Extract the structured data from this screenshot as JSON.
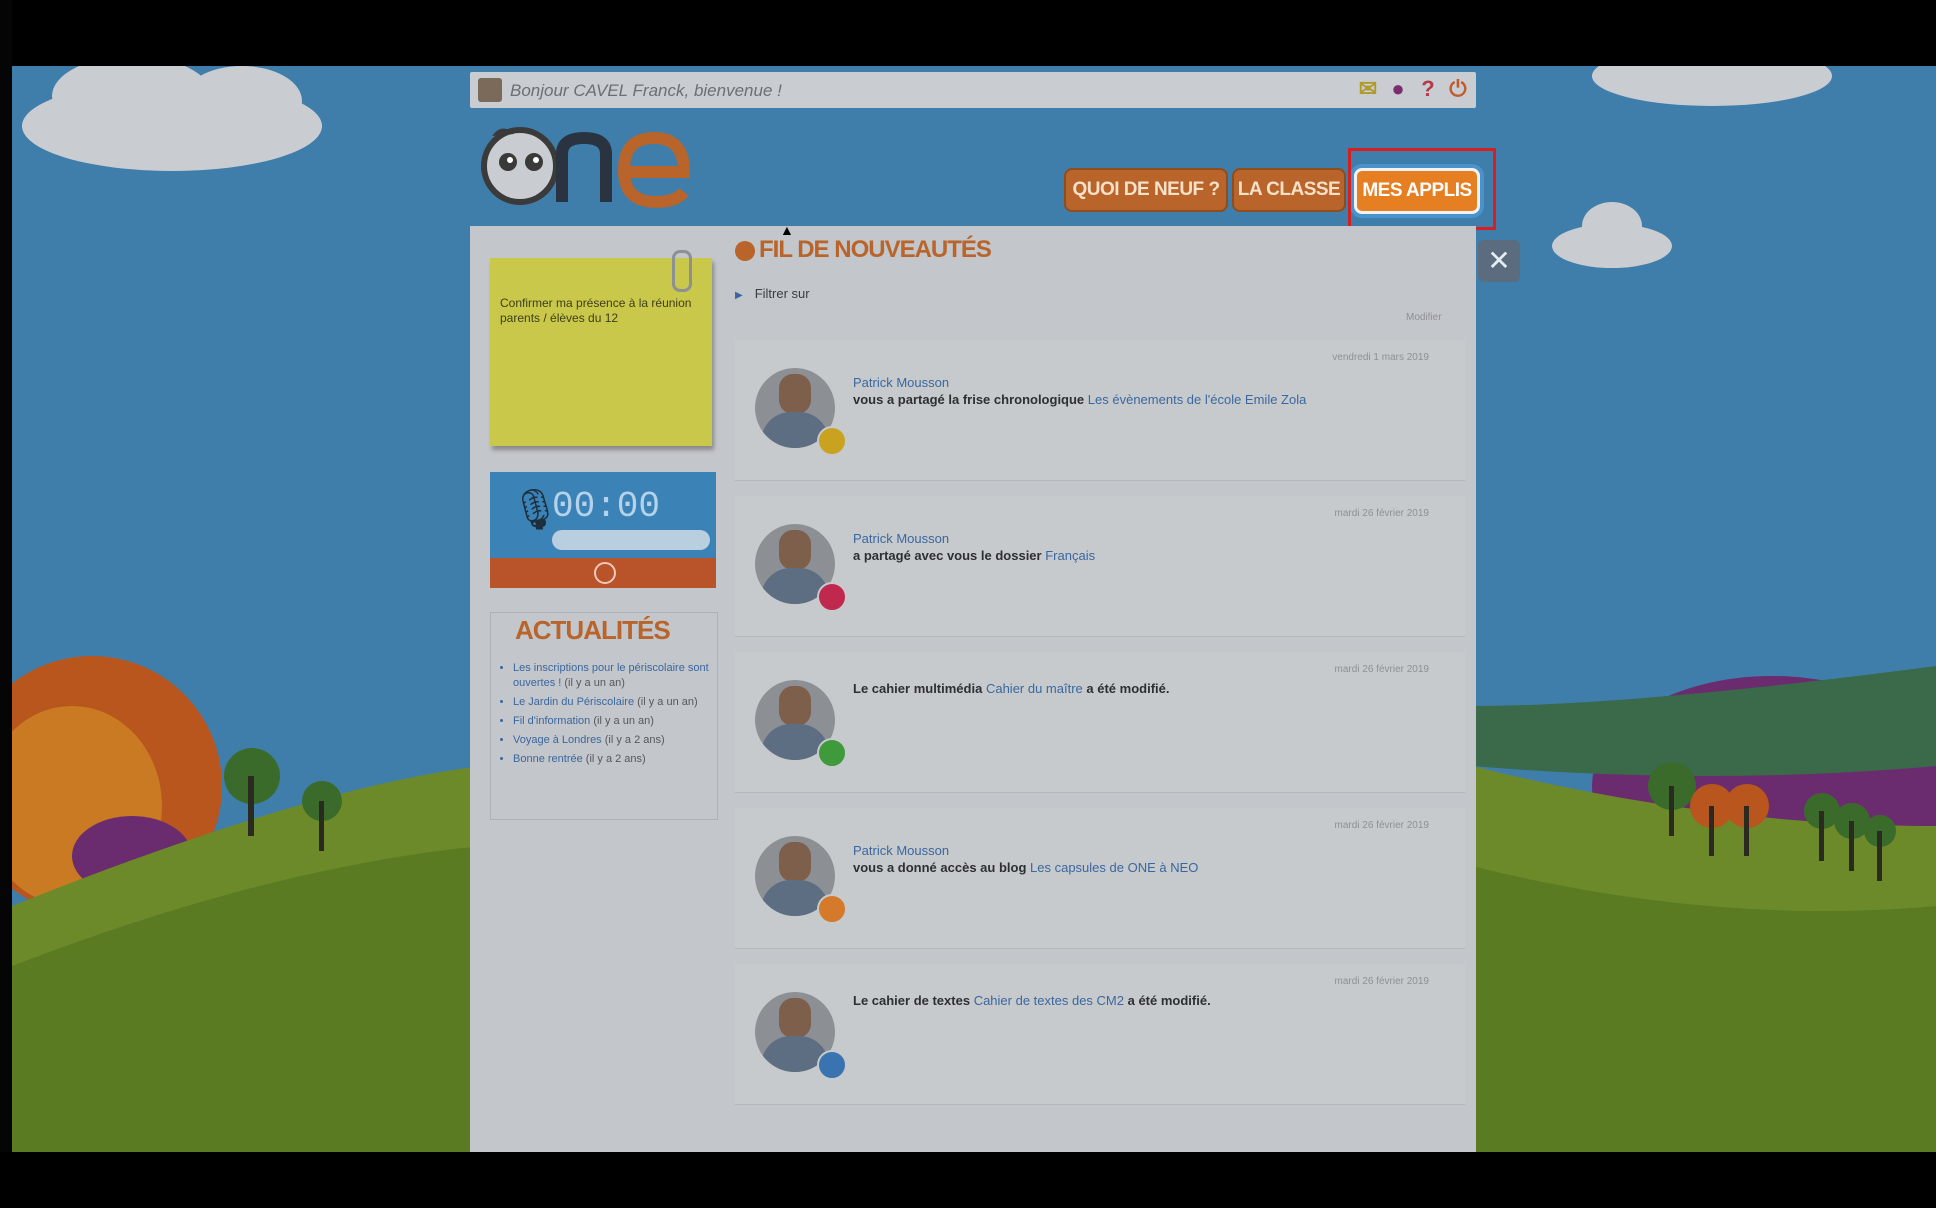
{
  "header": {
    "greeting": "Bonjour CAVEL Franck, bienvenue !",
    "icons": [
      "mail-icon",
      "user-icon",
      "help-icon",
      "power-icon"
    ]
  },
  "nav": {
    "items": [
      "QUOI DE NEUF ?",
      "LA CLASSE",
      "MES APPLIS"
    ],
    "active": "MES APPLIS"
  },
  "sidebar": {
    "postit_text": "Confirmer ma présence à la réunion parents / élèves du 12",
    "recorder_time": "00:00",
    "news_title": "ACTUALITÉS",
    "news": [
      {
        "title": "Les inscriptions pour le périscolaire sont ouvertes !",
        "age": "(il y a un an)"
      },
      {
        "title": "Le Jardin du Périscolaire",
        "age": "(il y a un an)"
      },
      {
        "title": "Fil d'information",
        "age": "(il y a un an)"
      },
      {
        "title": "Voyage à Londres",
        "age": "(il y a 2 ans)"
      },
      {
        "title": "Bonne rentrée",
        "age": "(il y a 2 ans)"
      }
    ]
  },
  "feed": {
    "title": "FIL DE NOUVEAUTÉS",
    "filter": "Filtrer sur",
    "show_all": "Modifier",
    "items": [
      {
        "date": "vendredi 1 mars 2019",
        "author": "Patrick Mousson",
        "text": "vous a partagé la frise chronologique",
        "link": "Les évènements de l'école Emile Zola",
        "badge_color": "#c9a220"
      },
      {
        "date": "mardi 26 février 2019",
        "author": "Patrick Mousson",
        "text": "a partagé avec vous le dossier",
        "link": "Français",
        "badge_color": "#c0284e"
      },
      {
        "date": "mardi 26 février 2019",
        "author": "",
        "text": "Le cahier multimédia",
        "link": "Cahier du maître",
        "suffix": "a été modifié.",
        "badge_color": "#3e9a3a"
      },
      {
        "date": "mardi 26 février 2019",
        "author": "Patrick Mousson",
        "text": "vous a donné accès au blog",
        "link": "Les capsules de ONE à NEO",
        "badge_color": "#d47a2a"
      },
      {
        "date": "mardi 26 février 2019",
        "author": "",
        "text": "Le cahier de textes",
        "link": "Cahier de textes des CM2",
        "suffix": "a été modifié.",
        "badge_color": "#3a74b0"
      }
    ]
  },
  "colors": {
    "accent": "#e67e22",
    "highlight": "#d81e1e",
    "sky": "#3f7eaa"
  }
}
